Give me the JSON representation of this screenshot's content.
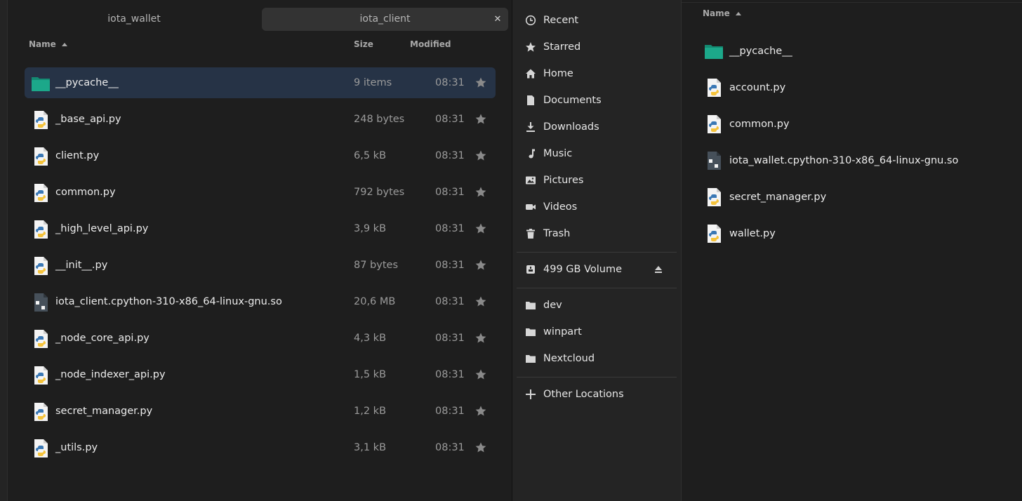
{
  "tabs": [
    {
      "label": "iota_wallet"
    },
    {
      "label": "iota_client"
    }
  ],
  "tab_close_glyph": "✕",
  "left_columns": {
    "name": "Name",
    "size": "Size",
    "modified": "Modified"
  },
  "left_files": [
    {
      "name": "__pycache__",
      "size": "9 items",
      "time": "08:31",
      "icon": "folder-icon",
      "selected": true
    },
    {
      "name": "_base_api.py",
      "size": "248 bytes",
      "time": "08:31",
      "icon": "python-file-icon"
    },
    {
      "name": "client.py",
      "size": "6,5 kB",
      "time": "08:31",
      "icon": "python-file-icon"
    },
    {
      "name": "common.py",
      "size": "792 bytes",
      "time": "08:31",
      "icon": "python-file-icon"
    },
    {
      "name": "_high_level_api.py",
      "size": "3,9 kB",
      "time": "08:31",
      "icon": "python-file-icon"
    },
    {
      "name": "__init__.py",
      "size": "87 bytes",
      "time": "08:31",
      "icon": "python-file-icon"
    },
    {
      "name": "iota_client.cpython-310-x86_64-linux-gnu.so",
      "size": "20,6 MB",
      "time": "08:31",
      "icon": "shared-library-icon"
    },
    {
      "name": "_node_core_api.py",
      "size": "4,3 kB",
      "time": "08:31",
      "icon": "python-file-icon"
    },
    {
      "name": "_node_indexer_api.py",
      "size": "1,5 kB",
      "time": "08:31",
      "icon": "python-file-icon"
    },
    {
      "name": "secret_manager.py",
      "size": "1,2 kB",
      "time": "08:31",
      "icon": "python-file-icon"
    },
    {
      "name": "_utils.py",
      "size": "3,1 kB",
      "time": "08:31",
      "icon": "python-file-icon"
    }
  ],
  "sidebar": {
    "places": [
      {
        "label": "Recent",
        "icon": "clock-icon"
      },
      {
        "label": "Starred",
        "icon": "star-icon"
      },
      {
        "label": "Home",
        "icon": "home-icon"
      },
      {
        "label": "Documents",
        "icon": "document-icon"
      },
      {
        "label": "Downloads",
        "icon": "download-icon"
      },
      {
        "label": "Music",
        "icon": "music-icon"
      },
      {
        "label": "Pictures",
        "icon": "pictures-icon"
      },
      {
        "label": "Videos",
        "icon": "video-icon"
      },
      {
        "label": "Trash",
        "icon": "trash-icon"
      }
    ],
    "volume": {
      "label": "499 GB Volume",
      "icon": "drive-icon"
    },
    "bookmarks": [
      {
        "label": "dev",
        "icon": "folder-icon"
      },
      {
        "label": "winpart",
        "icon": "folder-icon"
      },
      {
        "label": "Nextcloud",
        "icon": "folder-icon"
      }
    ],
    "other": {
      "label": "Other Locations",
      "icon": "plus-icon"
    }
  },
  "right_columns": {
    "name": "Name"
  },
  "right_files": [
    {
      "name": "__pycache__",
      "icon": "folder-icon"
    },
    {
      "name": "account.py",
      "icon": "python-file-icon"
    },
    {
      "name": "common.py",
      "icon": "python-file-icon"
    },
    {
      "name": "iota_wallet.cpython-310-x86_64-linux-gnu.so",
      "icon": "shared-library-icon"
    },
    {
      "name": "secret_manager.py",
      "icon": "python-file-icon"
    },
    {
      "name": "wallet.py",
      "icon": "python-file-icon"
    }
  ],
  "colors": {
    "selection": "#263346",
    "folder": "#1ca88a",
    "python_blue": "#3a78b5",
    "python_yellow": "#f5c33b"
  }
}
